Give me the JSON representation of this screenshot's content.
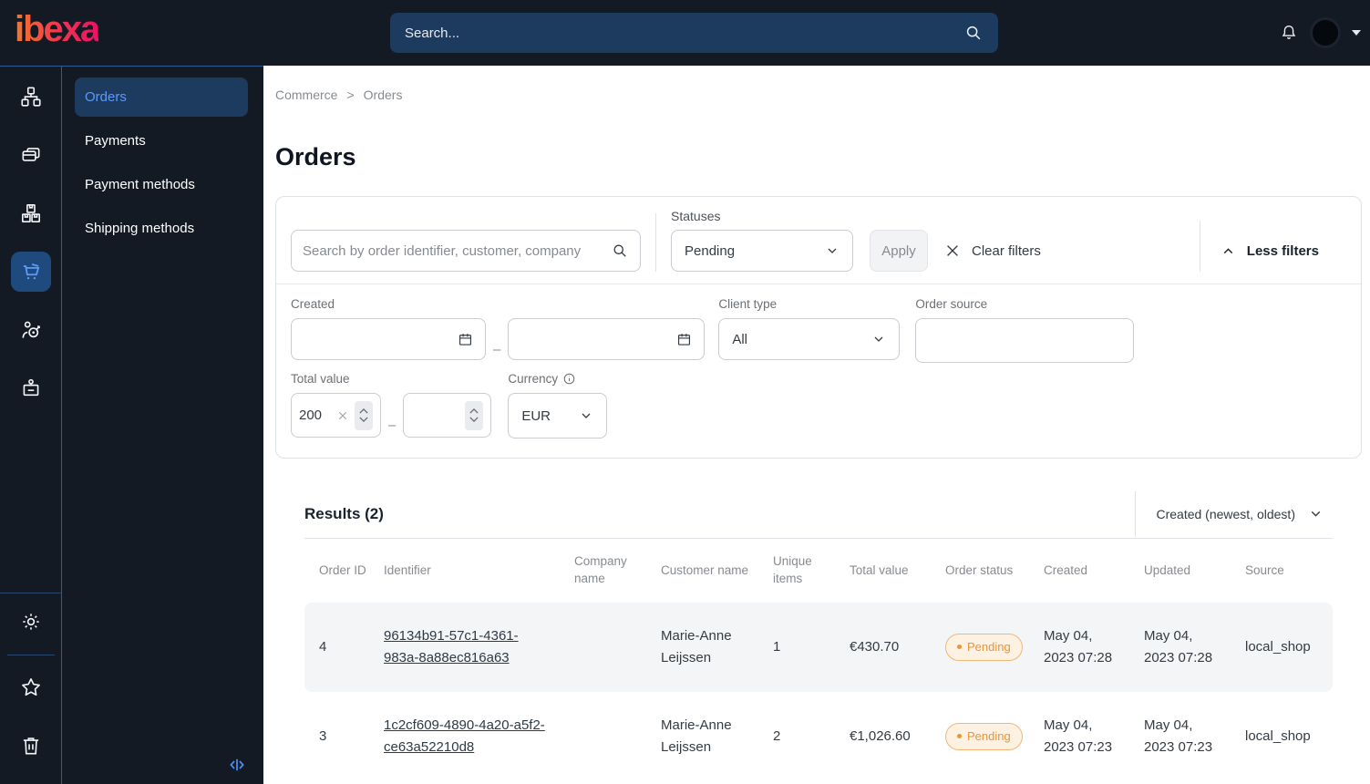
{
  "topbar": {
    "logo": "ibexa",
    "search_placeholder": "Search...",
    "icons": {
      "search": "search-icon",
      "notifications": "bell-icon",
      "profile": "avatar",
      "profile_caret": "caret-down-icon"
    }
  },
  "sidebar": {
    "rail_icons": [
      "sitemap-icon",
      "pages-icon",
      "products-icon",
      "cart-icon",
      "customers-icon",
      "storefront-icon"
    ],
    "rail_active_icon": "cart-icon",
    "rail_bottom_icons": [
      "gear-icon",
      "star-icon",
      "trash-icon"
    ],
    "collapse_icon": "collapse-panel-icon",
    "menu": [
      {
        "label": "Orders",
        "active": true
      },
      {
        "label": "Payments",
        "active": false
      },
      {
        "label": "Payment methods",
        "active": false
      },
      {
        "label": "Shipping methods",
        "active": false
      }
    ]
  },
  "breadcrumb": {
    "items": [
      "Commerce",
      "Orders"
    ],
    "separator": ">"
  },
  "page_title": "Orders",
  "filters": {
    "search_placeholder": "Search by order identifier, customer, company",
    "statuses_label": "Statuses",
    "statuses_value": "Pending",
    "apply_label": "Apply",
    "clear_label": "Clear filters",
    "toggle_label": "Less filters",
    "created_label": "Created",
    "range_separator": "–",
    "created_from": "",
    "created_to": "",
    "client_type_label": "Client type",
    "client_type_value": "All",
    "order_source_label": "Order source",
    "order_source_value": "",
    "total_value_label": "Total value",
    "total_value_min": "200",
    "total_value_max": "",
    "currency_label": "Currency",
    "currency_value": "EUR"
  },
  "results": {
    "title": "Results (2)",
    "sort_label": "Created (newest, oldest)",
    "columns": [
      "Order ID",
      "Identifier",
      "Company name",
      "Customer name",
      "Unique items",
      "Total value",
      "Order status",
      "Created",
      "Updated",
      "Source"
    ],
    "rows": [
      {
        "order_id": "4",
        "identifier": "96134b91-57c1-4361-983a-8a88ec816a63",
        "company_name": "",
        "customer_name": "Marie-Anne Leijssen",
        "unique_items": "1",
        "total_value": "€430.70",
        "order_status": "Pending",
        "created": "May 04, 2023 07:28",
        "updated": "May 04, 2023 07:28",
        "source": "local_shop"
      },
      {
        "order_id": "3",
        "identifier": "1c2cf609-4890-4a20-a5f2-ce63a52210d8",
        "company_name": "",
        "customer_name": "Marie-Anne Leijssen",
        "unique_items": "2",
        "total_value": "€1,026.60",
        "order_status": "Pending",
        "created": "May 04, 2023 07:23",
        "updated": "May 04, 2023 07:23",
        "source": "local_shop"
      }
    ]
  },
  "colors": {
    "topbar_bg": "#141a24",
    "accent_blue": "#5b9bf8",
    "active_item_bg": "#1d3a5f",
    "sidebar_divider_blue": "#2e5c99",
    "status_pending_text": "#e9953a",
    "status_pending_border": "#f2b679",
    "status_pending_bg": "#fdf1e2",
    "logo_gradient_start": "#f4772e",
    "logo_gradient_end": "#ed1164",
    "row_alt_bg": "#f4f5f6"
  }
}
